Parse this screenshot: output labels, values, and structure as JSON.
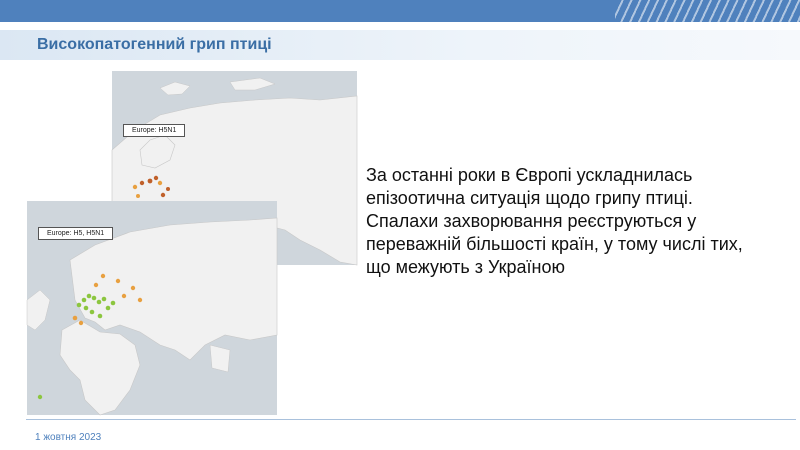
{
  "slide": {
    "title": "Високопатогенний грип птиці",
    "body": "За останні роки в Європі ускладнилась епізоотична ситуація щодо грипу птиці. Спалахи захворювання реєструються у переважній більшості країн, у тому числі тих, що межують з Україною",
    "date": "1 жовтня 2023"
  },
  "maps": {
    "top_label": "Europe: H5N1",
    "bottom_label": "Europe: H5, H5N1"
  },
  "colors": {
    "accent": "#4f81bd",
    "title": "#3a6ea5",
    "map_water": "#cfd6dc",
    "map_land": "#f1f1f1",
    "outbreak_orange": "#e8a040",
    "outbreak_red": "#c0602a",
    "outbreak_green": "#8cc63f"
  }
}
